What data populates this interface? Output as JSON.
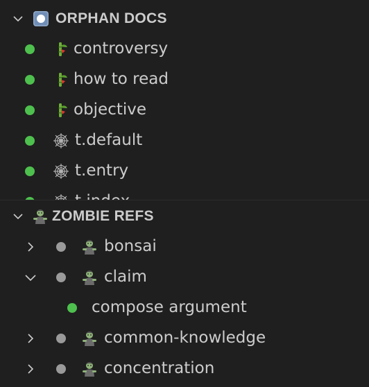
{
  "orphan_docs": {
    "title": "ORPHAN DOCS",
    "header_icon": "record-button-icon",
    "items": [
      {
        "label": "controversy",
        "icon": "bamboo-icon",
        "status": "#4ec04e"
      },
      {
        "label": "how to read",
        "icon": "bamboo-icon",
        "status": "#4ec04e"
      },
      {
        "label": "objective",
        "icon": "bamboo-icon",
        "status": "#4ec04e"
      },
      {
        "label": "t.default",
        "icon": "spider-web-icon",
        "status": "#4ec04e"
      },
      {
        "label": "t.entry",
        "icon": "spider-web-icon",
        "status": "#4ec04e"
      },
      {
        "label": "t.index",
        "icon": "spider-web-icon",
        "status": "#4ec04e"
      }
    ]
  },
  "zombie_refs": {
    "title": "ZOMBIE REFS",
    "header_icon": "zombie-icon",
    "items": [
      {
        "label": "bonsai",
        "icon": "zombie-icon",
        "status": "#9a9a9a",
        "expanded": false
      },
      {
        "label": "claim",
        "icon": "zombie-icon",
        "status": "#9a9a9a",
        "expanded": true,
        "children": [
          {
            "label": "compose argument",
            "status": "#4ec04e"
          }
        ]
      },
      {
        "label": "common-knowledge",
        "icon": "zombie-icon",
        "status": "#9a9a9a",
        "expanded": false
      },
      {
        "label": "concentration",
        "icon": "zombie-icon",
        "status": "#9a9a9a",
        "expanded": false
      }
    ]
  },
  "colors": {
    "background": "#1f1f1f",
    "text": "#cccccc",
    "status_green": "#4ec04e",
    "status_gray": "#9a9a9a"
  }
}
